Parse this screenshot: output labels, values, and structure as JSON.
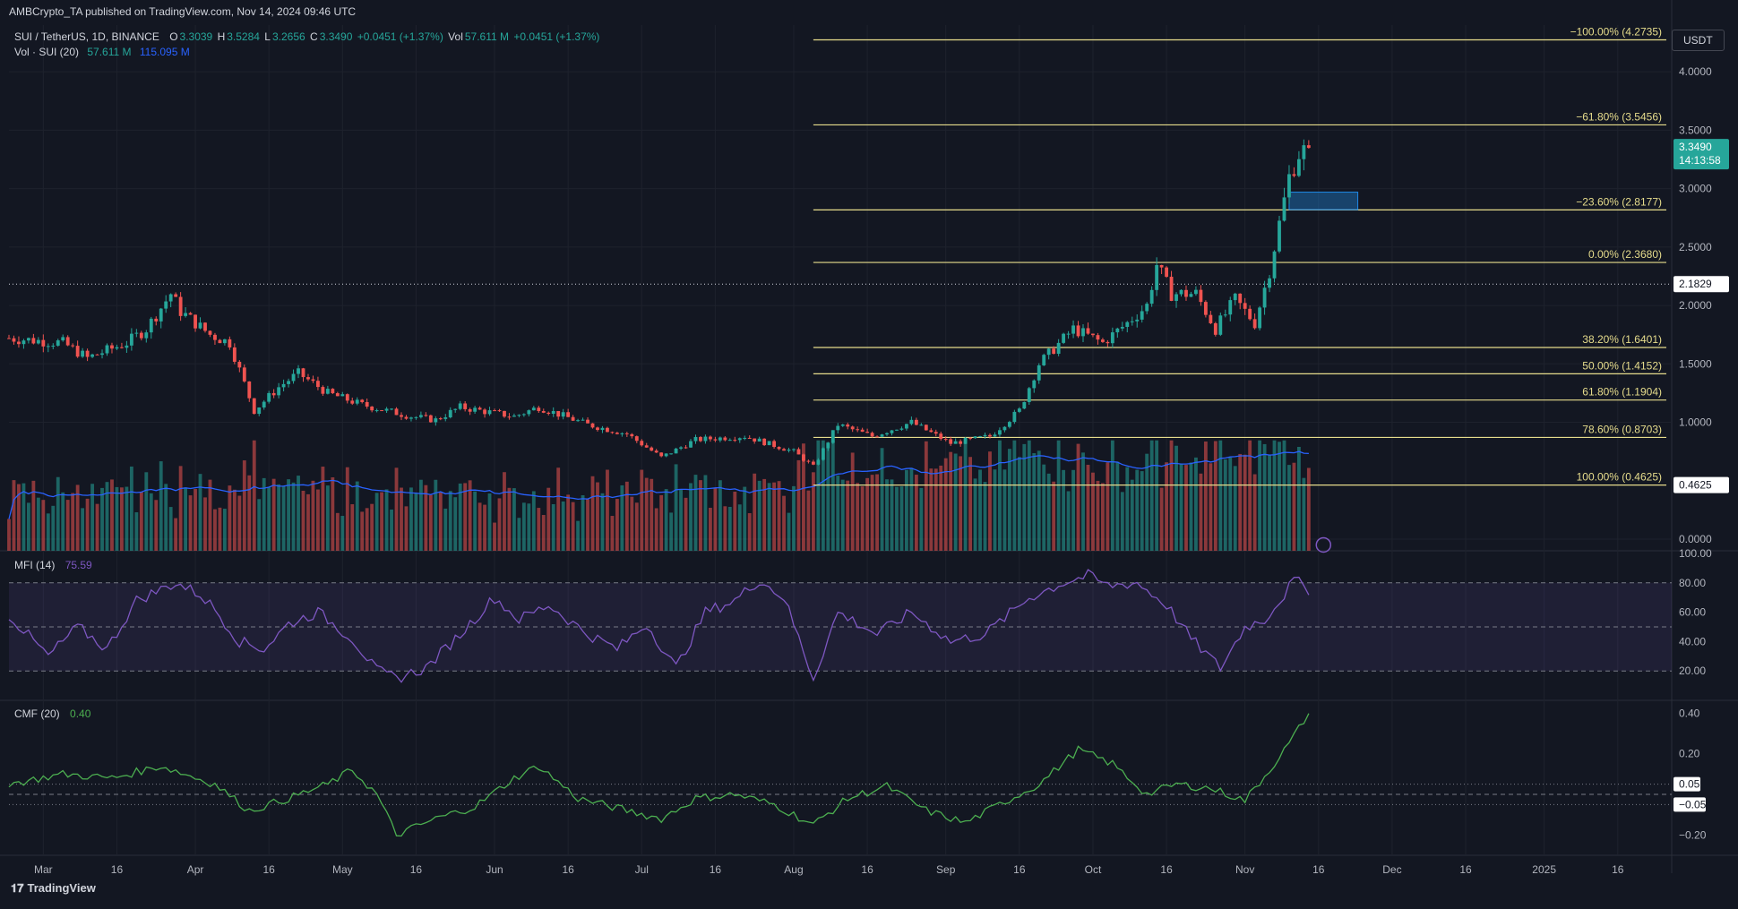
{
  "header": {
    "publisher": "AMBCrypto_TA published on TradingView.com, Nov 14, 2024 09:46 UTC",
    "symbol": "SUI / TetherUS, 1D, BINANCE",
    "ohlc": {
      "o_label": "O",
      "o": "3.3039",
      "h_label": "H",
      "h": "3.5284",
      "l_label": "L",
      "l": "3.2656",
      "c_label": "C",
      "c": "3.3490",
      "chg": "+0.0451 (+1.37%)",
      "vol_label": "Vol",
      "vol": "57.611 M",
      "vol_chg": "+0.0451 (+1.37%)"
    },
    "vol_indicator": {
      "label": "Vol · SUI (20)",
      "vol": "57.611 M",
      "ma": "115.095 M"
    },
    "currency": "USDT"
  },
  "colors": {
    "bg": "#131722",
    "up": "#26a69a",
    "down": "#ef5350",
    "fib": "#e6dc8c",
    "ma": "#2962ff",
    "mfi": "#7e57c2",
    "cmf": "#4caf50"
  },
  "chart_data": [
    {
      "type": "candlestick",
      "title": "SUI / TetherUS, 1D, BINANCE",
      "ylim": [
        -0.1,
        4.4
      ],
      "y_ticks": [
        0.0,
        1.0,
        1.5,
        2.0,
        2.5,
        3.0,
        3.5,
        4.0
      ],
      "y_tick_labels": [
        "0.0000",
        "1.0000",
        "1.5000",
        "2.0000",
        "2.5000",
        "3.0000",
        "3.5000",
        "4.0000"
      ],
      "x_tick_labels": [
        "Mar",
        "16",
        "Apr",
        "16",
        "May",
        "16",
        "Jun",
        "16",
        "Jul",
        "16",
        "Aug",
        "16",
        "Sep",
        "16",
        "Oct",
        "16",
        "Nov",
        "16",
        "Dec",
        "16",
        "2025",
        "16"
      ],
      "x_tick_dates": [
        "2024-03-01",
        "2024-03-16",
        "2024-04-01",
        "2024-04-16",
        "2024-05-01",
        "2024-05-16",
        "2024-06-01",
        "2024-06-16",
        "2024-07-01",
        "2024-07-16",
        "2024-08-01",
        "2024-08-16",
        "2024-09-01",
        "2024-09-16",
        "2024-10-01",
        "2024-10-16",
        "2024-11-01",
        "2024-11-16",
        "2024-12-01",
        "2024-12-16",
        "2025-01-01",
        "2025-01-16"
      ],
      "x_range": [
        "2024-02-23",
        "2025-01-27"
      ],
      "price_anchors": [
        [
          "2024-02-23",
          1.72
        ],
        [
          "2024-03-05",
          1.68
        ],
        [
          "2024-03-10",
          1.55
        ],
        [
          "2024-03-18",
          1.68
        ],
        [
          "2024-03-22",
          1.8
        ],
        [
          "2024-03-27",
          2.1
        ],
        [
          "2024-03-29",
          1.95
        ],
        [
          "2024-04-04",
          1.75
        ],
        [
          "2024-04-08",
          1.68
        ],
        [
          "2024-04-13",
          1.1
        ],
        [
          "2024-04-18",
          1.3
        ],
        [
          "2024-04-22",
          1.42
        ],
        [
          "2024-04-28",
          1.25
        ],
        [
          "2024-05-05",
          1.15
        ],
        [
          "2024-05-15",
          1.05
        ],
        [
          "2024-05-20",
          1.02
        ],
        [
          "2024-05-25",
          1.13
        ],
        [
          "2024-06-05",
          1.05
        ],
        [
          "2024-06-10",
          1.13
        ],
        [
          "2024-06-20",
          0.98
        ],
        [
          "2024-06-28",
          0.9
        ],
        [
          "2024-07-05",
          0.7
        ],
        [
          "2024-07-12",
          0.85
        ],
        [
          "2024-07-22",
          0.88
        ],
        [
          "2024-08-01",
          0.75
        ],
        [
          "2024-08-05",
          0.62
        ],
        [
          "2024-08-10",
          0.98
        ],
        [
          "2024-08-17",
          0.88
        ],
        [
          "2024-08-25",
          1.0
        ],
        [
          "2024-09-02",
          0.82
        ],
        [
          "2024-09-10",
          0.88
        ],
        [
          "2024-09-16",
          1.1
        ],
        [
          "2024-09-20",
          1.5
        ],
        [
          "2024-09-27",
          1.8
        ],
        [
          "2024-10-03",
          1.68
        ],
        [
          "2024-10-08",
          1.85
        ],
        [
          "2024-10-12",
          2.0
        ],
        [
          "2024-10-14",
          2.35
        ],
        [
          "2024-10-17",
          2.1
        ],
        [
          "2024-10-22",
          2.1
        ],
        [
          "2024-10-26",
          1.8
        ],
        [
          "2024-10-30",
          2.05
        ],
        [
          "2024-11-03",
          1.85
        ],
        [
          "2024-11-06",
          2.3
        ],
        [
          "2024-11-08",
          2.7
        ],
        [
          "2024-11-10",
          3.1
        ],
        [
          "2024-11-12",
          3.3
        ],
        [
          "2024-11-14",
          3.349
        ]
      ],
      "last_price": "3.3490",
      "countdown": "14:13:58",
      "hline_label": "2.1829",
      "ma_label": "0.4625",
      "fib_levels": [
        {
          "label": "−100.00% (4.2735)",
          "value": 4.2735
        },
        {
          "label": "−61.80% (3.5456)",
          "value": 3.5456
        },
        {
          "label": "−23.60% (2.8177)",
          "value": 2.8177
        },
        {
          "label": "0.00% (2.3680)",
          "value": 2.368
        },
        {
          "label": "38.20% (1.6401)",
          "value": 1.6401
        },
        {
          "label": "50.00% (1.4152)",
          "value": 1.4152
        },
        {
          "label": "61.80% (1.1904)",
          "value": 1.1904
        },
        {
          "label": "78.60% (0.8703)",
          "value": 0.8703
        },
        {
          "label": "100.00% (0.4625)",
          "value": 0.4625
        }
      ],
      "fib_start": "2024-08-05",
      "dotted_level": 2.1829,
      "order_block": {
        "x": [
          "2024-11-10",
          "2024-11-24"
        ],
        "y": [
          2.82,
          2.97
        ]
      }
    },
    {
      "type": "line",
      "name": "MFI (14)",
      "last_value": "75.59",
      "ylim": [
        0,
        100
      ],
      "y_ticks": [
        20,
        40,
        60,
        80,
        100
      ],
      "y_tick_labels": [
        "20.00",
        "40.00",
        "60.00",
        "80.00",
        "100.00"
      ],
      "bands": [
        20,
        50,
        80
      ],
      "anchors": [
        [
          "2024-02-23",
          58
        ],
        [
          "2024-03-02",
          30
        ],
        [
          "2024-03-08",
          50
        ],
        [
          "2024-03-14",
          35
        ],
        [
          "2024-03-20",
          68
        ],
        [
          "2024-03-28",
          80
        ],
        [
          "2024-04-02",
          72
        ],
        [
          "2024-04-05",
          62
        ],
        [
          "2024-04-10",
          40
        ],
        [
          "2024-04-15",
          35
        ],
        [
          "2024-04-20",
          52
        ],
        [
          "2024-04-26",
          60
        ],
        [
          "2024-05-03",
          42
        ],
        [
          "2024-05-08",
          20
        ],
        [
          "2024-05-12",
          15
        ],
        [
          "2024-05-18",
          22
        ],
        [
          "2024-05-25",
          45
        ],
        [
          "2024-06-01",
          70
        ],
        [
          "2024-06-06",
          55
        ],
        [
          "2024-06-12",
          65
        ],
        [
          "2024-06-20",
          45
        ],
        [
          "2024-06-26",
          35
        ],
        [
          "2024-07-02",
          52
        ],
        [
          "2024-07-08",
          22
        ],
        [
          "2024-07-14",
          60
        ],
        [
          "2024-07-20",
          68
        ],
        [
          "2024-07-25",
          82
        ],
        [
          "2024-07-30",
          70
        ],
        [
          "2024-08-05",
          15
        ],
        [
          "2024-08-10",
          60
        ],
        [
          "2024-08-18",
          45
        ],
        [
          "2024-08-25",
          60
        ],
        [
          "2024-09-02",
          40
        ],
        [
          "2024-09-09",
          45
        ],
        [
          "2024-09-18",
          70
        ],
        [
          "2024-09-25",
          80
        ],
        [
          "2024-09-30",
          85
        ],
        [
          "2024-10-04",
          78
        ],
        [
          "2024-10-10",
          80
        ],
        [
          "2024-10-16",
          65
        ],
        [
          "2024-10-21",
          42
        ],
        [
          "2024-10-27",
          22
        ],
        [
          "2024-11-01",
          50
        ],
        [
          "2024-11-05",
          55
        ],
        [
          "2024-11-09",
          72
        ],
        [
          "2024-11-11",
          82
        ],
        [
          "2024-11-14",
          75.59
        ]
      ]
    },
    {
      "type": "line",
      "name": "CMF (20)",
      "last_value": "0.40",
      "ylim": [
        -0.3,
        0.45
      ],
      "y_ticks": [
        -0.2,
        0.2,
        0.4
      ],
      "y_tick_labels": [
        "−0.20",
        "0.20",
        "0.40"
      ],
      "bands": [
        0.05,
        0,
        -0.05
      ],
      "band_labels": [
        "0.05",
        "−0.05"
      ],
      "anchors": [
        [
          "2024-02-23",
          0.05
        ],
        [
          "2024-03-05",
          0.1
        ],
        [
          "2024-03-15",
          0.08
        ],
        [
          "2024-03-25",
          0.14
        ],
        [
          "2024-04-05",
          0.05
        ],
        [
          "2024-04-12",
          -0.08
        ],
        [
          "2024-04-20",
          -0.02
        ],
        [
          "2024-04-28",
          0.05
        ],
        [
          "2024-05-03",
          0.12
        ],
        [
          "2024-05-08",
          0.0
        ],
        [
          "2024-05-12",
          -0.2
        ],
        [
          "2024-05-20",
          -0.12
        ],
        [
          "2024-05-28",
          -0.06
        ],
        [
          "2024-06-05",
          0.08
        ],
        [
          "2024-06-10",
          0.14
        ],
        [
          "2024-06-18",
          -0.02
        ],
        [
          "2024-06-28",
          -0.08
        ],
        [
          "2024-07-05",
          -0.12
        ],
        [
          "2024-07-12",
          -0.02
        ],
        [
          "2024-07-20",
          0.0
        ],
        [
          "2024-07-28",
          -0.05
        ],
        [
          "2024-08-05",
          -0.15
        ],
        [
          "2024-08-12",
          -0.02
        ],
        [
          "2024-08-20",
          0.04
        ],
        [
          "2024-08-28",
          -0.08
        ],
        [
          "2024-09-05",
          -0.14
        ],
        [
          "2024-09-12",
          -0.05
        ],
        [
          "2024-09-20",
          0.05
        ],
        [
          "2024-09-28",
          0.22
        ],
        [
          "2024-10-05",
          0.15
        ],
        [
          "2024-10-12",
          0.0
        ],
        [
          "2024-10-18",
          0.05
        ],
        [
          "2024-10-25",
          0.03
        ],
        [
          "2024-11-01",
          -0.03
        ],
        [
          "2024-11-06",
          0.12
        ],
        [
          "2024-11-10",
          0.25
        ],
        [
          "2024-11-14",
          0.4
        ]
      ]
    }
  ],
  "branding": "TradingView"
}
